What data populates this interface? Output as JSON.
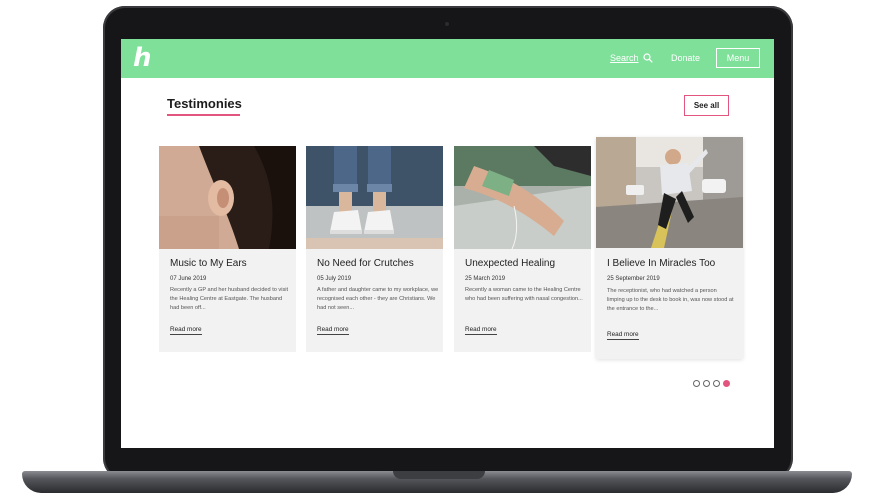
{
  "header": {
    "logo": "h",
    "search_label": "Search",
    "donate_label": "Donate",
    "menu_label": "Menu",
    "accent": "#7fe09a"
  },
  "section": {
    "title": "Testimonies",
    "see_all": "See all",
    "accent": "#e2557f"
  },
  "cards": [
    {
      "title": "Music to My Ears",
      "date": "07 June 2019",
      "excerpt": "Recently a GP and her husband decided to visit the Healing Centre at Eastgate. The husband had been off...",
      "link": "Read more"
    },
    {
      "title": "No Need for Crutches",
      "date": "05 July 2019",
      "excerpt": "A father and daughter came to my workplace, we recognised each other - they are Christians. We had not seen...",
      "link": "Read more"
    },
    {
      "title": "Unexpected Healing",
      "date": "25 March 2019",
      "excerpt": "Recently a woman came to the Healing Centre who had been suffering with nasal congestion...",
      "link": "Read more"
    },
    {
      "title": "I Believe In Miracles Too",
      "date": "25 September 2019",
      "excerpt": "The receptionist, who had watched a person limping up to the desk to book in, was now stood at the entrance to the...",
      "link": "Read more"
    }
  ],
  "pagination": {
    "total": 4,
    "active_index": 4
  }
}
